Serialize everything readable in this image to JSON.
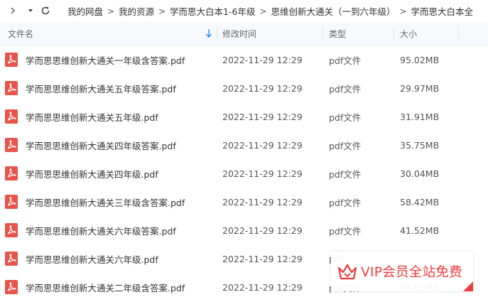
{
  "toolbar": {
    "back_icon": "chevron-right-icon",
    "menu_icon": "caret-down-icon",
    "refresh_icon": "refresh-icon",
    "breadcrumb": [
      "我的网盘",
      "我的资源",
      "学而思大白本1-6年级",
      "思维创新大通关（一到六年级）",
      "学而思大白本全"
    ],
    "separator": ">"
  },
  "header": {
    "name": "文件名",
    "modified": "修改时间",
    "type": "类型",
    "size": "大小",
    "sort_icon": "sort-down-arrow-icon",
    "accent": "#2b8bf5"
  },
  "files": [
    {
      "name": "学而思思维创新大通关一年级含答案.pdf",
      "modified": "2022-11-29 12:29",
      "type": "pdf文件",
      "size": "95.02MB"
    },
    {
      "name": "学而思思维创新大通关五年级答案.pdf",
      "modified": "2022-11-29 12:29",
      "type": "pdf文件",
      "size": "29.97MB"
    },
    {
      "name": "学而思思维创新大通关五年级.pdf",
      "modified": "2022-11-29 12:29",
      "type": "pdf文件",
      "size": "31.91MB"
    },
    {
      "name": "学而思思维创新大通关四年级答案.pdf",
      "modified": "2022-11-29 12:29",
      "type": "pdf文件",
      "size": "35.75MB"
    },
    {
      "name": "学而思思维创新大通关四年级.pdf",
      "modified": "2022-11-29 12:29",
      "type": "pdf文件",
      "size": "30.04MB"
    },
    {
      "name": "学而思思维创新大通关三年级含答案.pdf",
      "modified": "2022-11-29 12:29",
      "type": "pdf文件",
      "size": "58.42MB"
    },
    {
      "name": "学而思思维创新大通关六年级答案.pdf",
      "modified": "2022-11-29 12:29",
      "type": "pdf文件",
      "size": "41.52MB"
    },
    {
      "name": "学而思思维创新大通关六年级.pdf",
      "modified": "2022-11-29 12:29",
      "type": "pdf",
      "size": ""
    },
    {
      "name": "学而思思维创新大通关二年级含答案.pdf",
      "modified": "2022-11-29 12:29",
      "type": "pdf文件",
      "size": "98.03MB"
    }
  ],
  "file_icon": "pdf-file-icon",
  "pdf_icon_color": "#e8534a",
  "watermark": {
    "text": "VIP会员全站免费",
    "icon": "crown-icon",
    "color": "#f23b3b"
  }
}
